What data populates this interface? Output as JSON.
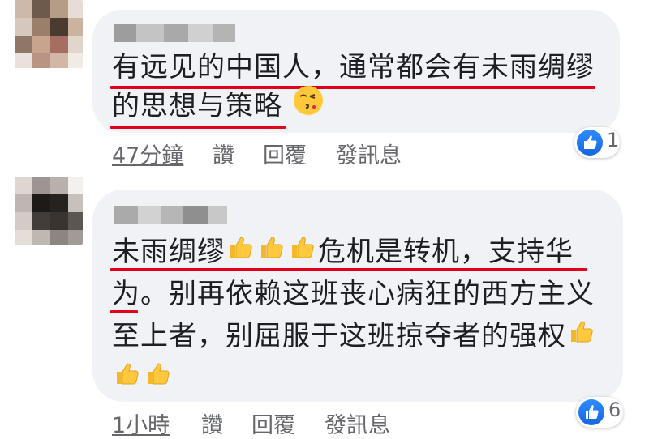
{
  "comments": [
    {
      "text_lines": [
        "有远见的中国人，通常都会有未雨绸缪",
        "的思想与策略"
      ],
      "emoji": "kissing-face-icon",
      "actions": {
        "time": "47分鐘",
        "like": "讚",
        "reply": "回覆",
        "message": "發訊息"
      },
      "reaction_count": "1"
    },
    {
      "line1_a": "未雨绸缪",
      "line1_b": "危机是转机，支持华",
      "line2": "为。别再依赖这班丧心病狂的西方主义",
      "line3": "至上者，别屈服于这班掠夺者的强权",
      "emoji": "thumbs-up-icon",
      "actions": {
        "time": "1小時",
        "like": "讚",
        "reply": "回覆",
        "message": "發訊息"
      },
      "reaction_count": "6"
    }
  ],
  "colors": {
    "bubble": "#f0f2f5",
    "underline": "#e3001b",
    "meta": "#65676b",
    "like_blue": "#1877f2"
  }
}
